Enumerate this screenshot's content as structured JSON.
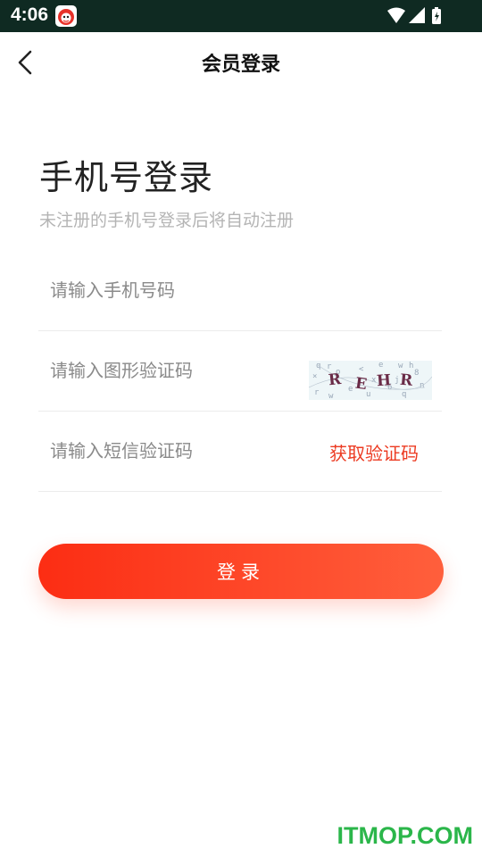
{
  "status_bar": {
    "time": "4:06",
    "icons": [
      "app-notification-icon",
      "wifi-icon",
      "cellular-signal-icon",
      "battery-charging-icon"
    ]
  },
  "header": {
    "title": "会员登录",
    "back_icon": "chevron-left-icon"
  },
  "main": {
    "heading": "手机号登录",
    "subheading": "未注册的手机号登录后将自动注册",
    "phone_field": {
      "placeholder": "请输入手机号码",
      "value": ""
    },
    "captcha_field": {
      "placeholder": "请输入图形验证码",
      "value": "",
      "captcha_text": "REHR"
    },
    "sms_field": {
      "placeholder": "请输入短信验证码",
      "value": "",
      "send_code_label": "获取验证码"
    },
    "login_label": "登录"
  },
  "watermark": "ITMOP.COM",
  "colors": {
    "status_bar_bg": "#0f2a22",
    "accent": "#ec3b22",
    "button_gradient_start": "#fc2d13",
    "button_gradient_end": "#ff5f3c",
    "watermark": "#2bb64a"
  }
}
